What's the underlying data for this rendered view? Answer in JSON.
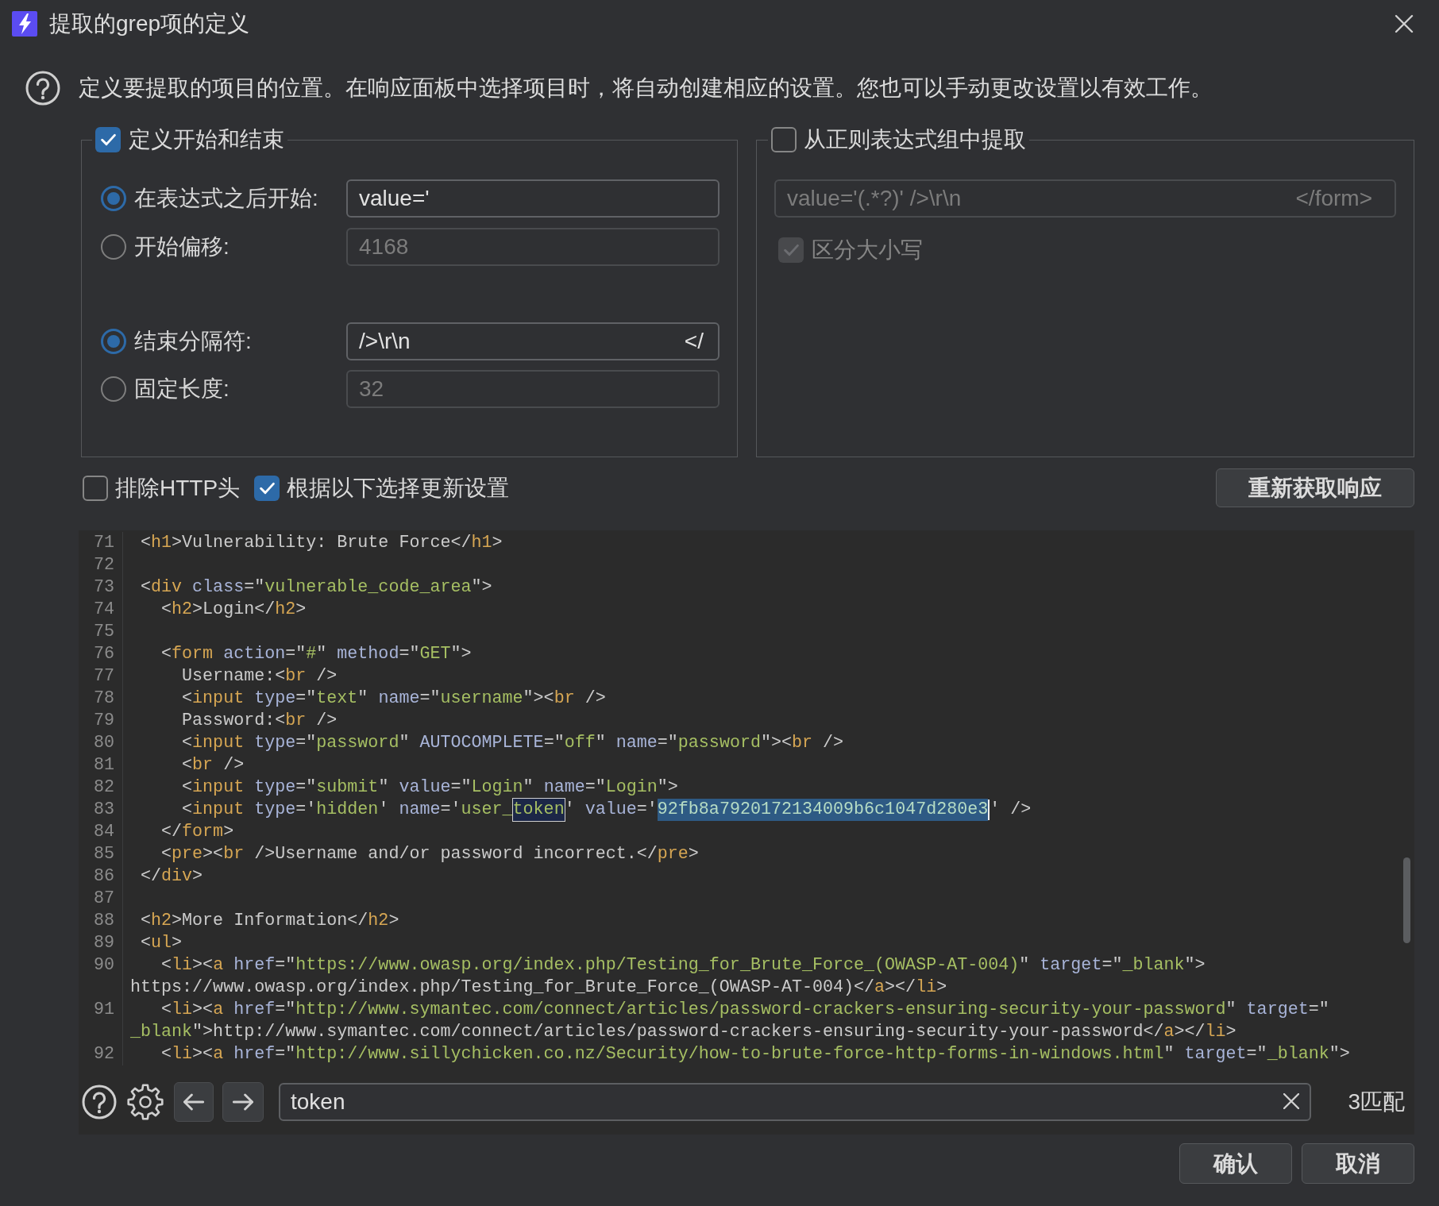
{
  "window": {
    "title": "提取的grep项的定义"
  },
  "description": "定义要提取的项目的位置。在响应面板中选择项目时，将自动创建相应的设置。您也可以手动更改设置以有效工作。",
  "start_end_group": {
    "label": "定义开始和结束",
    "checked": true,
    "start_options": [
      {
        "label": "在表达式之后开始:",
        "selected": true,
        "field": {
          "value_segments": [
            "value='"
          ],
          "disabled": false
        }
      },
      {
        "label": "开始偏移:",
        "selected": false,
        "field": {
          "value_segments": [
            "4168"
          ],
          "disabled": true
        }
      }
    ],
    "end_options": [
      {
        "label": "结束分隔符:",
        "selected": true,
        "field": {
          "value_segments": [
            "/>\\r\\n",
            "</"
          ],
          "disabled": false
        }
      },
      {
        "label": "固定长度:",
        "selected": false,
        "field": {
          "value_segments": [
            "32"
          ],
          "disabled": true
        }
      }
    ]
  },
  "regex_group": {
    "label": "从正则表达式组中提取",
    "checked": false,
    "field": {
      "value_segments": [
        "value='(.*?)' />\\r\\n",
        "</form>"
      ],
      "disabled": true
    },
    "case_sensitive": {
      "label": "区分大小写",
      "checked": true,
      "disabled": true
    }
  },
  "options": [
    {
      "label": "排除HTTP头",
      "checked": false
    },
    {
      "label": "根据以下选择更新设置",
      "checked": true
    }
  ],
  "refetch_button": "重新获取响应",
  "response_view": {
    "lines": [
      {
        "number": "71",
        "segments": [
          {
            "kind": "text",
            "text": " <"
          },
          {
            "kind": "tag",
            "text": "h1"
          },
          {
            "kind": "text",
            "text": ">Vulnerability: Brute Force</"
          },
          {
            "kind": "tag",
            "text": "h1"
          },
          {
            "kind": "text",
            "text": ">"
          }
        ]
      },
      {
        "number": "72"
      },
      {
        "number": "73",
        "segments": [
          {
            "kind": "text",
            "text": " <"
          },
          {
            "kind": "tag",
            "text": "div"
          },
          {
            "kind": "attr",
            "text": " class"
          },
          {
            "kind": "text",
            "text": "=\""
          },
          {
            "kind": "value",
            "text": "vulnerable_code_area"
          },
          {
            "kind": "text",
            "text": "\">"
          }
        ]
      },
      {
        "number": "74",
        "segments": [
          {
            "kind": "text",
            "text": "   <"
          },
          {
            "kind": "tag",
            "text": "h2"
          },
          {
            "kind": "text",
            "text": ">Login</"
          },
          {
            "kind": "tag",
            "text": "h2"
          },
          {
            "kind": "text",
            "text": ">"
          }
        ]
      },
      {
        "number": "75"
      },
      {
        "number": "76",
        "segments": [
          {
            "kind": "text",
            "text": "   <"
          },
          {
            "kind": "tag",
            "text": "form"
          },
          {
            "kind": "attr",
            "text": " action"
          },
          {
            "kind": "text",
            "text": "=\""
          },
          {
            "kind": "value",
            "text": "#"
          },
          {
            "kind": "text",
            "text": "\" "
          },
          {
            "kind": "attr",
            "text": "method"
          },
          {
            "kind": "text",
            "text": "=\""
          },
          {
            "kind": "value",
            "text": "GET"
          },
          {
            "kind": "text",
            "text": "\">"
          }
        ]
      },
      {
        "number": "77",
        "segments": [
          {
            "kind": "text",
            "text": "     Username:<"
          },
          {
            "kind": "tag",
            "text": "br"
          },
          {
            "kind": "text",
            "text": " />"
          }
        ]
      },
      {
        "number": "78",
        "segments": [
          {
            "kind": "text",
            "text": "     <"
          },
          {
            "kind": "tag",
            "text": "input"
          },
          {
            "kind": "attr",
            "text": " type"
          },
          {
            "kind": "text",
            "text": "=\""
          },
          {
            "kind": "value",
            "text": "text"
          },
          {
            "kind": "text",
            "text": "\" "
          },
          {
            "kind": "attr",
            "text": "name"
          },
          {
            "kind": "text",
            "text": "=\""
          },
          {
            "kind": "value",
            "text": "username"
          },
          {
            "kind": "text",
            "text": "\"><"
          },
          {
            "kind": "tag",
            "text": "br"
          },
          {
            "kind": "text",
            "text": " />"
          }
        ]
      },
      {
        "number": "79",
        "segments": [
          {
            "kind": "text",
            "text": "     Password:<"
          },
          {
            "kind": "tag",
            "text": "br"
          },
          {
            "kind": "text",
            "text": " />"
          }
        ]
      },
      {
        "number": "80",
        "segments": [
          {
            "kind": "text",
            "text": "     <"
          },
          {
            "kind": "tag",
            "text": "input"
          },
          {
            "kind": "attr",
            "text": " type"
          },
          {
            "kind": "text",
            "text": "=\""
          },
          {
            "kind": "value",
            "text": "password"
          },
          {
            "kind": "text",
            "text": "\" "
          },
          {
            "kind": "attr",
            "text": "AUTOCOMPLETE"
          },
          {
            "kind": "text",
            "text": "=\""
          },
          {
            "kind": "value",
            "text": "off"
          },
          {
            "kind": "text",
            "text": "\" "
          },
          {
            "kind": "attr",
            "text": "name"
          },
          {
            "kind": "text",
            "text": "=\""
          },
          {
            "kind": "value",
            "text": "password"
          },
          {
            "kind": "text",
            "text": "\"><"
          },
          {
            "kind": "tag",
            "text": "br"
          },
          {
            "kind": "text",
            "text": " />"
          }
        ]
      },
      {
        "number": "81",
        "segments": [
          {
            "kind": "text",
            "text": "     <"
          },
          {
            "kind": "tag",
            "text": "br"
          },
          {
            "kind": "text",
            "text": " />"
          }
        ]
      },
      {
        "number": "82",
        "segments": [
          {
            "kind": "text",
            "text": "     <"
          },
          {
            "kind": "tag",
            "text": "input"
          },
          {
            "kind": "attr",
            "text": " type"
          },
          {
            "kind": "text",
            "text": "=\""
          },
          {
            "kind": "value",
            "text": "submit"
          },
          {
            "kind": "text",
            "text": "\" "
          },
          {
            "kind": "attr",
            "text": "value"
          },
          {
            "kind": "text",
            "text": "=\""
          },
          {
            "kind": "value",
            "text": "Login"
          },
          {
            "kind": "text",
            "text": "\" "
          },
          {
            "kind": "attr",
            "text": "name"
          },
          {
            "kind": "text",
            "text": "=\""
          },
          {
            "kind": "value",
            "text": "Login"
          },
          {
            "kind": "text",
            "text": "\">"
          }
        ]
      },
      {
        "number": "83",
        "segments": [
          {
            "kind": "text",
            "text": "     <"
          },
          {
            "kind": "tag",
            "text": "input"
          },
          {
            "kind": "attr",
            "text": " type"
          },
          {
            "kind": "text",
            "text": "='"
          },
          {
            "kind": "value",
            "text": "hidden"
          },
          {
            "kind": "text",
            "text": "' "
          },
          {
            "kind": "attr",
            "text": "name"
          },
          {
            "kind": "text",
            "text": "='"
          },
          {
            "kind": "value",
            "text": "user_"
          },
          {
            "kind": "match",
            "text": "token"
          },
          {
            "kind": "text",
            "text": "' "
          },
          {
            "kind": "attr",
            "text": "value"
          },
          {
            "kind": "text",
            "text": "='"
          },
          {
            "kind": "selection",
            "text": "92fb8a7920172134009b6c1047d280e3"
          },
          {
            "kind": "text",
            "text": "' />"
          }
        ]
      },
      {
        "number": "84",
        "segments": [
          {
            "kind": "text",
            "text": "   </"
          },
          {
            "kind": "tag",
            "text": "form"
          },
          {
            "kind": "text",
            "text": ">"
          }
        ]
      },
      {
        "number": "85",
        "segments": [
          {
            "kind": "text",
            "text": "   <"
          },
          {
            "kind": "tag",
            "text": "pre"
          },
          {
            "kind": "text",
            "text": "><"
          },
          {
            "kind": "tag",
            "text": "br"
          },
          {
            "kind": "text",
            "text": " />Username and/or password incorrect.</"
          },
          {
            "kind": "tag",
            "text": "pre"
          },
          {
            "kind": "text",
            "text": ">"
          }
        ]
      },
      {
        "number": "86",
        "segments": [
          {
            "kind": "text",
            "text": " </"
          },
          {
            "kind": "tag",
            "text": "div"
          },
          {
            "kind": "text",
            "text": ">"
          }
        ]
      },
      {
        "number": "87"
      },
      {
        "number": "88",
        "segments": [
          {
            "kind": "text",
            "text": " <"
          },
          {
            "kind": "tag",
            "text": "h2"
          },
          {
            "kind": "text",
            "text": ">More Information</"
          },
          {
            "kind": "tag",
            "text": "h2"
          },
          {
            "kind": "text",
            "text": ">"
          }
        ]
      },
      {
        "number": "89",
        "segments": [
          {
            "kind": "text",
            "text": " <"
          },
          {
            "kind": "tag",
            "text": "ul"
          },
          {
            "kind": "text",
            "text": ">"
          }
        ]
      },
      {
        "number": "90",
        "segments": [
          {
            "kind": "text",
            "text": "   <"
          },
          {
            "kind": "tag",
            "text": "li"
          },
          {
            "kind": "text",
            "text": "><"
          },
          {
            "kind": "tag",
            "text": "a"
          },
          {
            "kind": "attr",
            "text": " href"
          },
          {
            "kind": "text",
            "text": "=\""
          },
          {
            "kind": "value",
            "text": "https://www.owasp.org/index.php/Testing_for_Brute_Force_(OWASP-AT-004)"
          },
          {
            "kind": "text",
            "text": "\" "
          },
          {
            "kind": "attr",
            "text": "target"
          },
          {
            "kind": "text",
            "text": "=\""
          },
          {
            "kind": "value",
            "text": "_blank"
          },
          {
            "kind": "text",
            "text": "\">"
          }
        ],
        "wrapped_segments": [
          {
            "kind": "text",
            "text": "https://www.owasp.org/index.php/Testing_for_Brute_Force_(OWASP-AT-004)</"
          },
          {
            "kind": "tag",
            "text": "a"
          },
          {
            "kind": "text",
            "text": "></"
          },
          {
            "kind": "tag",
            "text": "li"
          },
          {
            "kind": "text",
            "text": ">"
          }
        ]
      },
      {
        "number": "91",
        "segments": [
          {
            "kind": "text",
            "text": "   <"
          },
          {
            "kind": "tag",
            "text": "li"
          },
          {
            "kind": "text",
            "text": "><"
          },
          {
            "kind": "tag",
            "text": "a"
          },
          {
            "kind": "attr",
            "text": " href"
          },
          {
            "kind": "text",
            "text": "=\""
          },
          {
            "kind": "value",
            "text": "http://www.symantec.com/connect/articles/password-crackers-ensuring-security-your-password"
          },
          {
            "kind": "text",
            "text": "\" "
          },
          {
            "kind": "attr",
            "text": "target"
          },
          {
            "kind": "text",
            "text": "=\""
          }
        ],
        "wrapped_segments": [
          {
            "kind": "value",
            "text": "_blank"
          },
          {
            "kind": "text",
            "text": "\">http://www.symantec.com/connect/articles/password-crackers-ensuring-security-your-password</"
          },
          {
            "kind": "tag",
            "text": "a"
          },
          {
            "kind": "text",
            "text": "></"
          },
          {
            "kind": "tag",
            "text": "li"
          },
          {
            "kind": "text",
            "text": ">"
          }
        ]
      },
      {
        "number": "92",
        "segments": [
          {
            "kind": "text",
            "text": "   <"
          },
          {
            "kind": "tag",
            "text": "li"
          },
          {
            "kind": "text",
            "text": "><"
          },
          {
            "kind": "tag",
            "text": "a"
          },
          {
            "kind": "attr",
            "text": " href"
          },
          {
            "kind": "text",
            "text": "=\""
          },
          {
            "kind": "value",
            "text": "http://www.sillychicken.co.nz/Security/how-to-brute-force-http-forms-in-windows.html"
          },
          {
            "kind": "text",
            "text": "\" "
          },
          {
            "kind": "attr",
            "text": "target"
          },
          {
            "kind": "text",
            "text": "=\""
          },
          {
            "kind": "value",
            "text": "_blank"
          },
          {
            "kind": "text",
            "text": "\">"
          }
        ]
      }
    ]
  },
  "search": {
    "value": "token",
    "match_count": "3匹配"
  },
  "buttons": [
    "确认",
    "取消"
  ]
}
